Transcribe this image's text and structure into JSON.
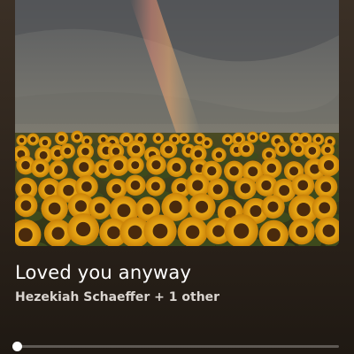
{
  "track": {
    "title": "Loved you anyway",
    "artists": "Hezekiah Schaeffer + 1 other"
  },
  "artwork": {
    "description_icon": "album-artwork-image"
  },
  "playback": {
    "progress_fraction": 0.0
  },
  "colors": {
    "background": "#2c231b",
    "text_primary": "#ffffff",
    "text_secondary": "#d9d4cf"
  }
}
